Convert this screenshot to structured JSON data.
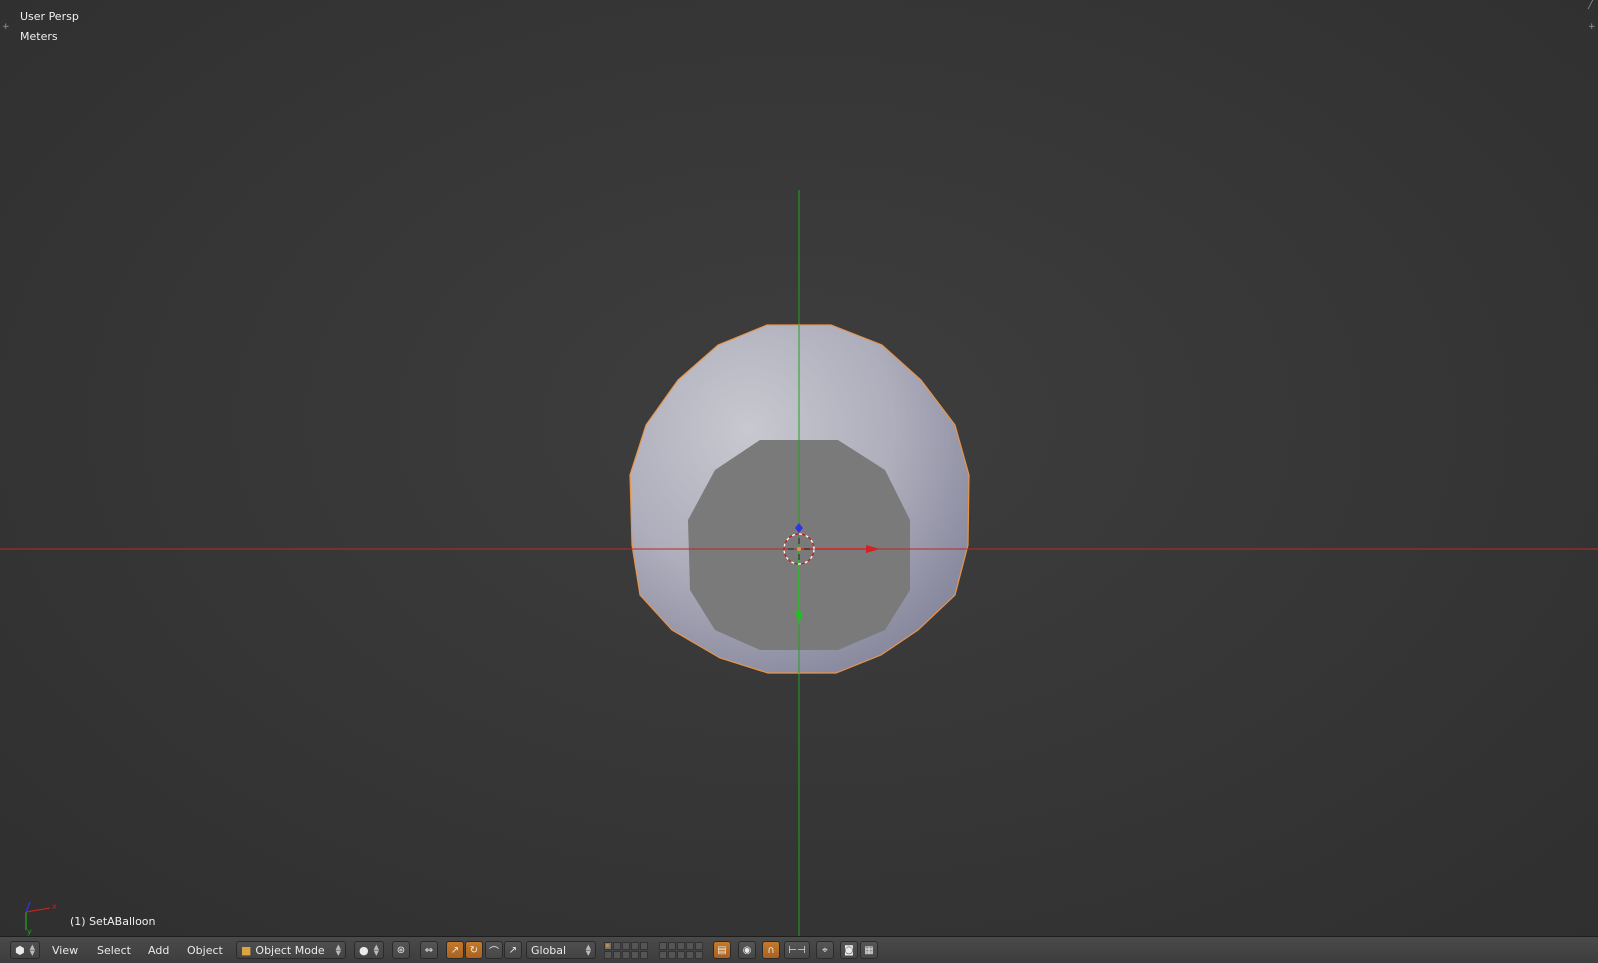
{
  "viewport": {
    "view_name": "User Persp",
    "units": "Meters",
    "active_object": "(1) SetABalloon"
  },
  "header": {
    "editor_type_icon": "cube-view-icon",
    "menus": [
      "View",
      "Select",
      "Add",
      "Object"
    ],
    "mode": "Object Mode",
    "orientation": "Global"
  },
  "colors": {
    "x_axis": "#c42020",
    "y_axis": "#1aa31a",
    "z_axis": "#2d36e0",
    "selection_outline": "#e8954a",
    "background": "#353535"
  }
}
